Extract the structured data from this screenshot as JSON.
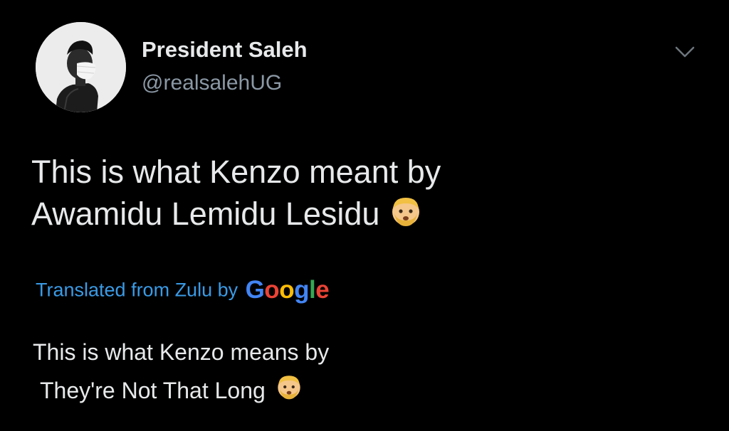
{
  "tweet": {
    "author": {
      "display_name": "President Saleh",
      "handle": "@realsalehUG",
      "avatar_icon": "profile-photo"
    },
    "menu_icon": "chevron-down-icon",
    "original_text": {
      "line1": "This is what Kenzo meant by",
      "line2": "Awamidu Lemidu Lesidu",
      "emoji": "man-blond-hair-beard-emoji"
    },
    "translation": {
      "label": "Translated from Zulu by",
      "provider": {
        "name": "Google",
        "letters": [
          "G",
          "o",
          "o",
          "g",
          "l",
          "e"
        ],
        "colors": [
          "#4285F4",
          "#EA4335",
          "#FBBC05",
          "#4285F4",
          "#34A853",
          "#EA4335"
        ]
      },
      "line1": "This is what Kenzo means by",
      "line2": "They're Not That Long",
      "emoji": "man-blond-hair-beard-emoji"
    }
  },
  "colors": {
    "background": "#000000",
    "text_primary": "#e7e9ea",
    "text_secondary": "#8b98a5",
    "link": "#3a9be6"
  }
}
